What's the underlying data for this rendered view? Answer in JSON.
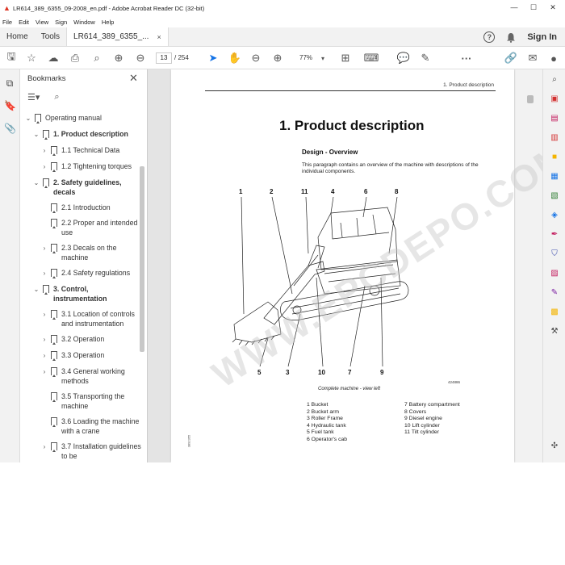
{
  "window": {
    "title": "LR614_389_6355_09-2008_en.pdf - Adobe Acrobat Reader DC (32-bit)",
    "minimize": "—",
    "maximize": "☐",
    "close": "✕"
  },
  "menu": [
    "File",
    "Edit",
    "View",
    "Sign",
    "Window",
    "Help"
  ],
  "tabs": {
    "home": "Home",
    "tools": "Tools",
    "document": "LR614_389_6355_...",
    "close": "×",
    "signin": "Sign In",
    "help": "?"
  },
  "toolbar": {
    "page_current": "13",
    "page_total": "/ 254",
    "zoom": "77%"
  },
  "bookmarks": {
    "title": "Bookmarks",
    "close": "✕",
    "items": [
      {
        "label": "Operating manual",
        "level": 0,
        "chev": "⌄",
        "bold": false
      },
      {
        "label": "1. Product description",
        "level": 1,
        "chev": "⌄",
        "bold": true
      },
      {
        "label": "1.1 Technical Data",
        "level": 2,
        "chev": "›",
        "bold": false
      },
      {
        "label": "1.2 Tightening torques",
        "level": 2,
        "chev": "›",
        "bold": false
      },
      {
        "label": "2. Safety guidelines, decals",
        "level": 1,
        "chev": "⌄",
        "bold": true
      },
      {
        "label": "2.1 Introduction",
        "level": 2,
        "chev": "",
        "bold": false
      },
      {
        "label": "2.2 Proper and intended use",
        "level": 2,
        "chev": "",
        "bold": false
      },
      {
        "label": "2.3 Decals on the machine",
        "level": 2,
        "chev": "›",
        "bold": false
      },
      {
        "label": "2.4 Safety regulations",
        "level": 2,
        "chev": "›",
        "bold": false
      },
      {
        "label": "3. Control, instrumentation",
        "level": 1,
        "chev": "⌄",
        "bold": true
      },
      {
        "label": "3.1 Location of controls and instrumentation",
        "level": 2,
        "chev": "›",
        "bold": false
      },
      {
        "label": "3.2 Operation",
        "level": 2,
        "chev": "›",
        "bold": false
      },
      {
        "label": "3.3 Operation",
        "level": 2,
        "chev": "›",
        "bold": false
      },
      {
        "label": "3.4 General working methods",
        "level": 2,
        "chev": "›",
        "bold": false
      },
      {
        "label": "3.5 Transporting the machine",
        "level": 2,
        "chev": "",
        "bold": false
      },
      {
        "label": "3.6 Loading the machine with a crane",
        "level": 2,
        "chev": "",
        "bold": false
      },
      {
        "label": "3.7 Installation guidelines to be",
        "level": 2,
        "chev": "›",
        "bold": false
      }
    ]
  },
  "document": {
    "running_head": "1. Product description",
    "heading": "1.   Product description",
    "subheading": "Design - Overview",
    "paragraph": "This paragraph contains an overview of the machine with descriptions of the individual components.",
    "caption": "Complete machine - view left",
    "figure_number": "424886",
    "side_code": "3892355",
    "watermark": "WWW.EPCDEPO.COM",
    "callouts_top": [
      "1",
      "2",
      "11",
      "4",
      "6",
      "8"
    ],
    "callouts_bottom": [
      "5",
      "3",
      "10",
      "7",
      "9"
    ],
    "legend_left": [
      "1 Bucket",
      "2 Bucket arm",
      "3 Roller Frame",
      "4 Hydraulic tank",
      "5 Fuel tank",
      "6 Operator's cab"
    ],
    "legend_right": [
      "7 Battery compartment",
      "8 Covers",
      "9 Diesel engine",
      "10 Lift cylinder",
      "11 Tilt cylinder"
    ]
  },
  "colors": {
    "accent": "#1473e6",
    "pdf_red": "#d32f2f"
  }
}
